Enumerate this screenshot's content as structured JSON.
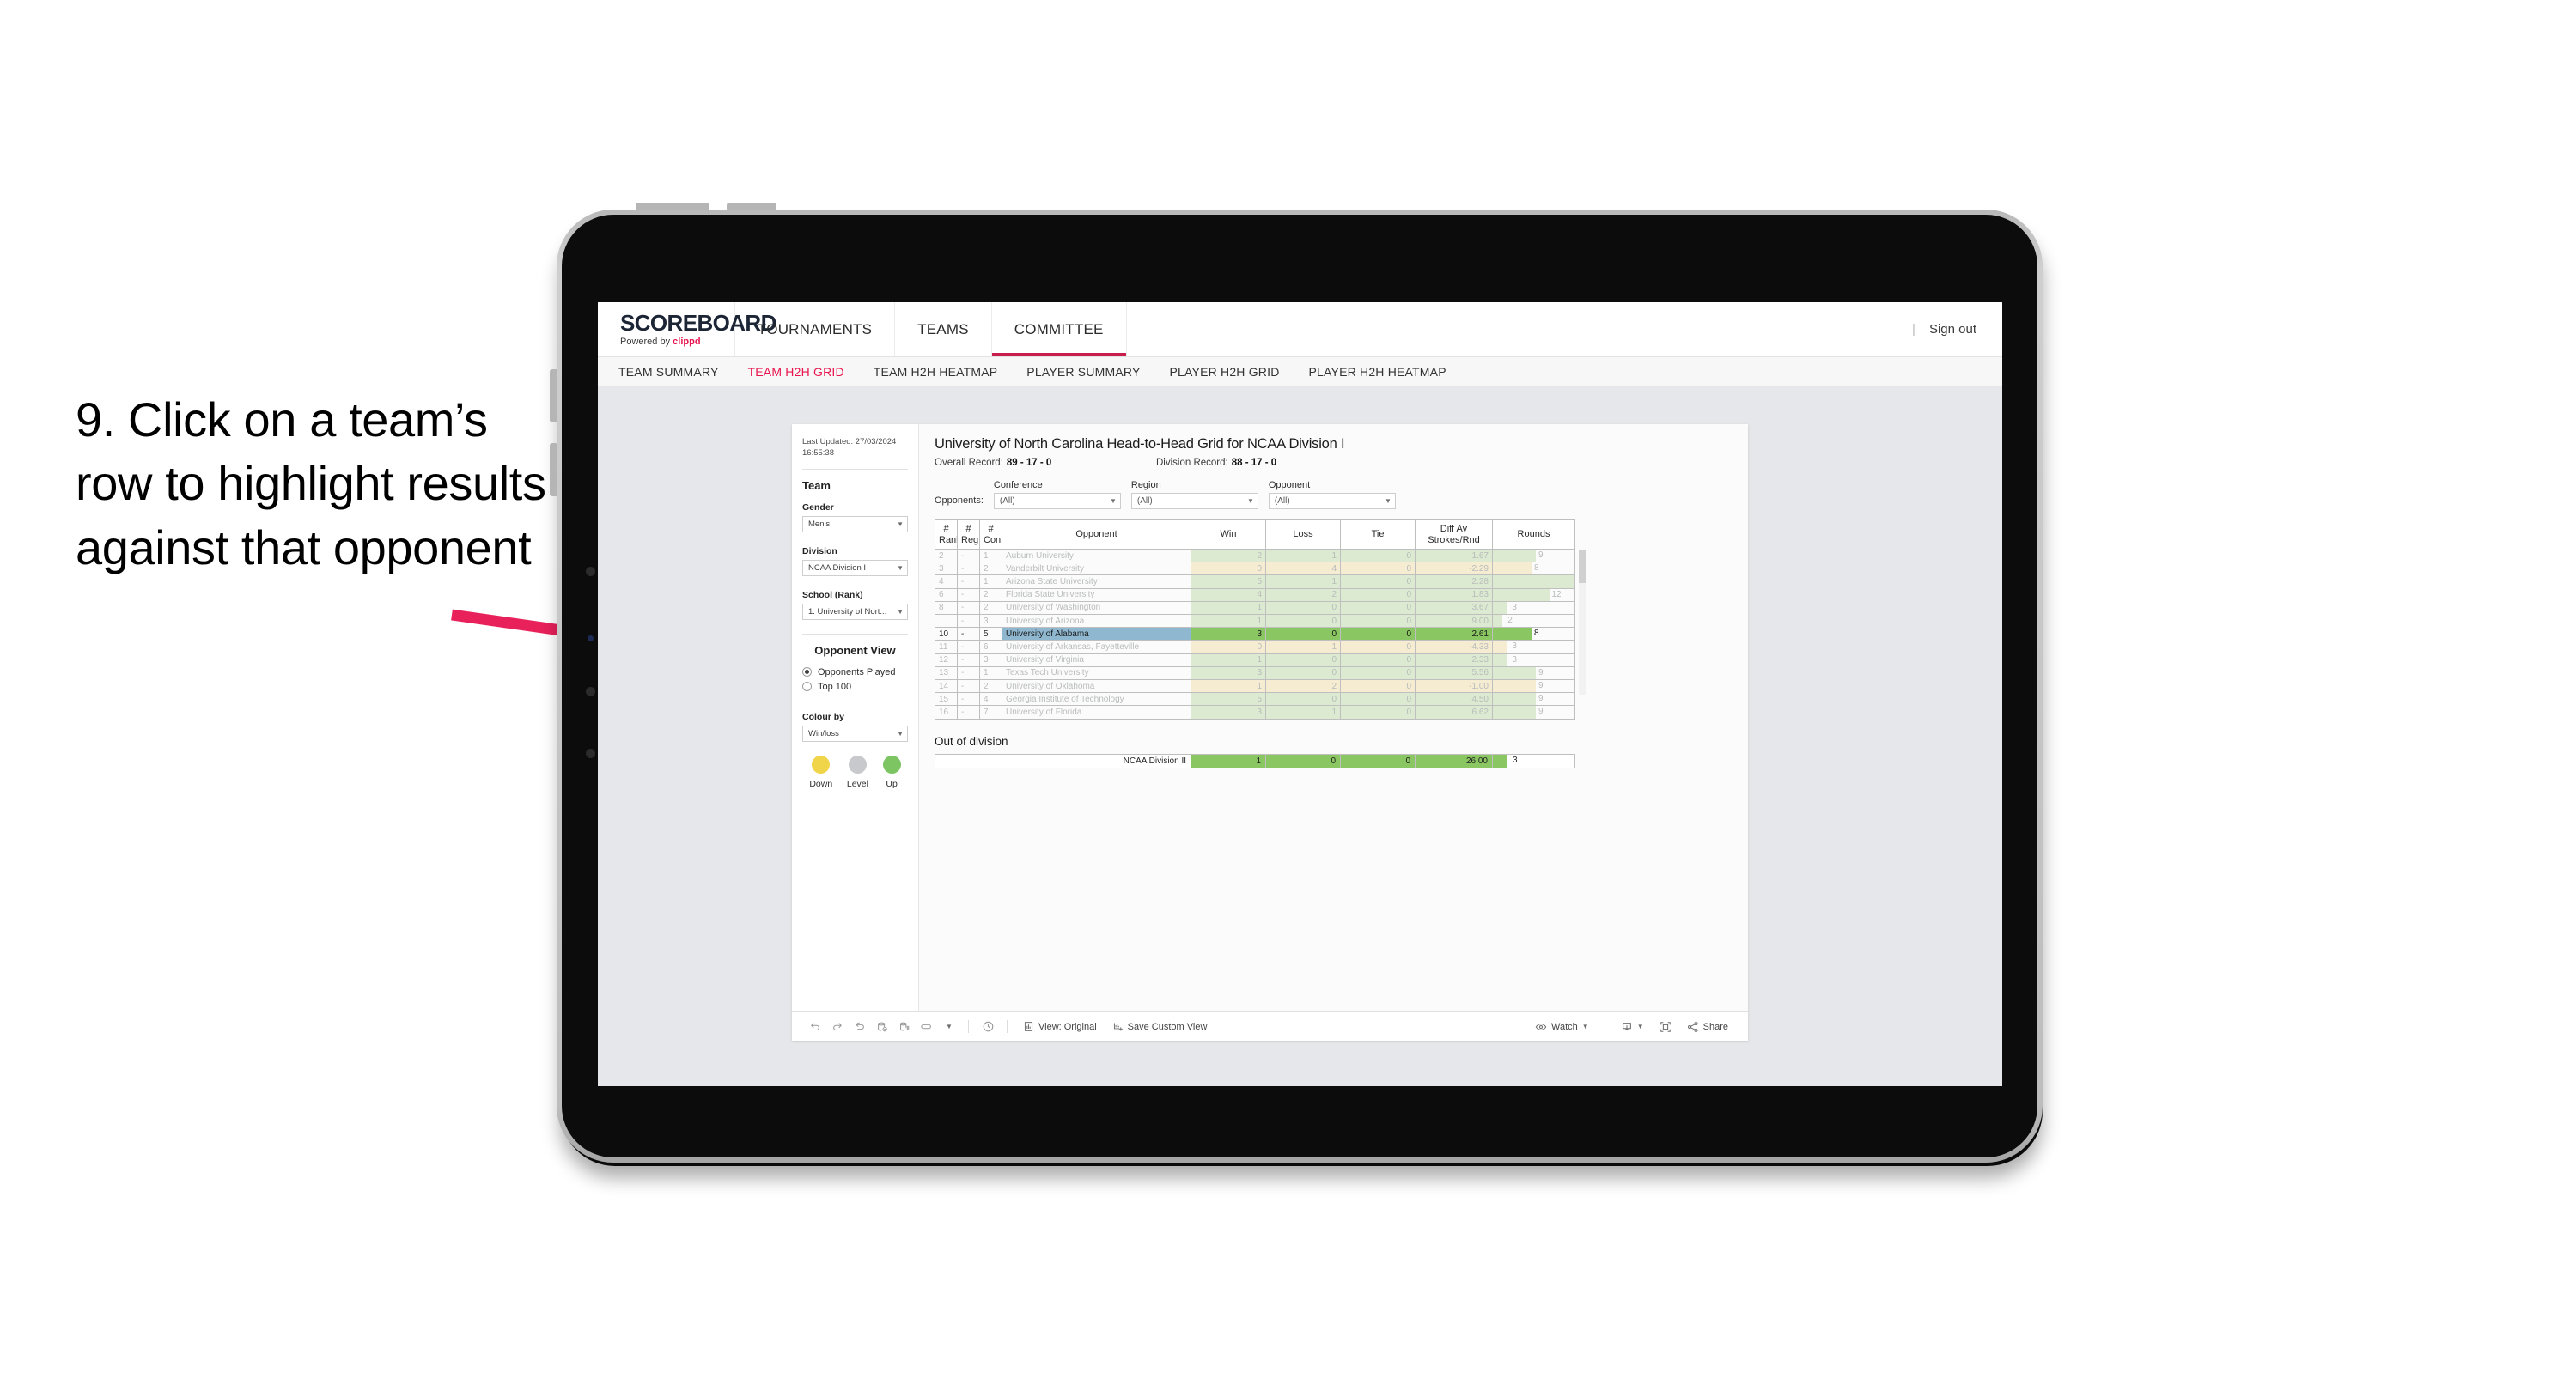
{
  "annotation": {
    "text": "9. Click on a team’s row to highlight results against that opponent",
    "arrow_color": "#E8215B"
  },
  "topbar": {
    "logo_word": "SCOREBOARD",
    "logo_sub_prefix": "Powered by ",
    "logo_sub_brand": "clippd",
    "nav": [
      {
        "label": "TOURNAMENTS",
        "active": false
      },
      {
        "label": "TEAMS",
        "active": false
      },
      {
        "label": "COMMITTEE",
        "active": true
      }
    ],
    "divider": "|",
    "sign_out": "Sign out"
  },
  "subnav": {
    "items": [
      {
        "label": "TEAM SUMMARY",
        "active": false
      },
      {
        "label": "TEAM H2H GRID",
        "active": true
      },
      {
        "label": "TEAM H2H HEATMAP",
        "active": false
      },
      {
        "label": "PLAYER SUMMARY",
        "active": false
      },
      {
        "label": "PLAYER H2H GRID",
        "active": false
      },
      {
        "label": "PLAYER H2H HEATMAP",
        "active": false
      }
    ]
  },
  "sidebar": {
    "last_updated": "Last Updated: 27/03/2024 16:55:38",
    "team_heading": "Team",
    "gender_label": "Gender",
    "gender_value": "Men’s",
    "division_label": "Division",
    "division_value": "NCAA Division I",
    "school_label": "School (Rank)",
    "school_value": "1. University of Nort...",
    "opponent_view_heading": "Opponent View",
    "opponent_view_options": [
      {
        "label": "Opponents Played",
        "selected": true
      },
      {
        "label": "Top 100",
        "selected": false
      }
    ],
    "colour_by_label": "Colour by",
    "colour_by_value": "Win/loss",
    "legend": [
      {
        "caption": "Down",
        "color": "#F0D54B"
      },
      {
        "caption": "Level",
        "color": "#C7C9CC"
      },
      {
        "caption": "Up",
        "color": "#7DC563"
      }
    ]
  },
  "viz": {
    "title": "University of North Carolina Head-to-Head Grid for NCAA Division I",
    "overall_record_label": "Overall Record:",
    "overall_record_value": "89 - 17 - 0",
    "division_record_label": "Division Record:",
    "division_record_value": "88 - 17 - 0",
    "filters_label": "Opponents:",
    "filters": [
      {
        "label": "Conference",
        "value": "(All)"
      },
      {
        "label": "Region",
        "value": "(All)"
      },
      {
        "label": "Opponent",
        "value": "(All)"
      }
    ]
  },
  "chart_data": {
    "type": "table",
    "title": "University of North Carolina Head-to-Head Grid for NCAA Division I",
    "columns": [
      "# Rank",
      "# Reg",
      "# Conf",
      "Opponent",
      "Win",
      "Loss",
      "Tie",
      "Diff Av Strokes/Rnd",
      "Rounds"
    ],
    "header_lines": [
      [
        "#",
        "Rank"
      ],
      [
        "#",
        "Reg"
      ],
      [
        "#",
        "Conf"
      ],
      [
        "Opponent"
      ],
      [
        "Win"
      ],
      [
        "Loss"
      ],
      [
        "Tie"
      ],
      [
        "Diff Av",
        "Strokes/Rnd"
      ],
      [
        "Rounds"
      ]
    ],
    "rounds_max": 17,
    "rows": [
      {
        "rank": "2",
        "reg": "-",
        "conf": "1",
        "opponent": "Auburn University",
        "win": "2",
        "loss": "1",
        "tie": "0",
        "diff": "1.67",
        "rounds": "9",
        "rounds_n": 9,
        "fill": "#dcead1",
        "highlight": false
      },
      {
        "rank": "3",
        "reg": "-",
        "conf": "2",
        "opponent": "Vanderbilt University",
        "win": "0",
        "loss": "4",
        "tie": "0",
        "diff": "-2.29",
        "rounds": "8",
        "rounds_n": 8,
        "fill": "#f5ecd2",
        "highlight": false
      },
      {
        "rank": "4",
        "reg": "-",
        "conf": "1",
        "opponent": "Arizona State University",
        "win": "5",
        "loss": "1",
        "tie": "0",
        "diff": "2.28",
        "rounds": "17",
        "rounds_n": 17,
        "fill": "#dcead1",
        "highlight": false
      },
      {
        "rank": "6",
        "reg": "-",
        "conf": "2",
        "opponent": "Florida State University",
        "win": "4",
        "loss": "2",
        "tie": "0",
        "diff": "1.83",
        "rounds": "12",
        "rounds_n": 12,
        "fill": "#dcead1",
        "highlight": false
      },
      {
        "rank": "8",
        "reg": "-",
        "conf": "2",
        "opponent": "University of Washington",
        "win": "1",
        "loss": "0",
        "tie": "0",
        "diff": "3.67",
        "rounds": "3",
        "rounds_n": 3,
        "fill": "#dcead1",
        "highlight": false
      },
      {
        "rank": "",
        "reg": "-",
        "conf": "3",
        "opponent": "University of Arizona",
        "win": "1",
        "loss": "0",
        "tie": "0",
        "diff": "9.00",
        "rounds": "2",
        "rounds_n": 2,
        "fill": "#dcead1",
        "highlight": false
      },
      {
        "rank": "10",
        "reg": "-",
        "conf": "5",
        "opponent": "University of Alabama",
        "win": "3",
        "loss": "0",
        "tie": "0",
        "diff": "2.61",
        "rounds": "8",
        "rounds_n": 8,
        "fill": "#8ac661",
        "highlight": true
      },
      {
        "rank": "11",
        "reg": "-",
        "conf": "6",
        "opponent": "University of Arkansas, Fayetteville",
        "win": "0",
        "loss": "1",
        "tie": "0",
        "diff": "-4.33",
        "rounds": "3",
        "rounds_n": 3,
        "fill": "#f5ecd2",
        "highlight": false
      },
      {
        "rank": "12",
        "reg": "-",
        "conf": "3",
        "opponent": "University of Virginia",
        "win": "1",
        "loss": "0",
        "tie": "0",
        "diff": "2.33",
        "rounds": "3",
        "rounds_n": 3,
        "fill": "#dcead1",
        "highlight": false
      },
      {
        "rank": "13",
        "reg": "-",
        "conf": "1",
        "opponent": "Texas Tech University",
        "win": "3",
        "loss": "0",
        "tie": "0",
        "diff": "5.56",
        "rounds": "9",
        "rounds_n": 9,
        "fill": "#dcead1",
        "highlight": false
      },
      {
        "rank": "14",
        "reg": "-",
        "conf": "2",
        "opponent": "University of Oklahoma",
        "win": "1",
        "loss": "2",
        "tie": "0",
        "diff": "-1.00",
        "rounds": "9",
        "rounds_n": 9,
        "fill": "#f5ecd2",
        "highlight": false
      },
      {
        "rank": "15",
        "reg": "-",
        "conf": "4",
        "opponent": "Georgia Institute of Technology",
        "win": "5",
        "loss": "0",
        "tie": "0",
        "diff": "4.50",
        "rounds": "9",
        "rounds_n": 9,
        "fill": "#dcead1",
        "highlight": false
      },
      {
        "rank": "16",
        "reg": "-",
        "conf": "7",
        "opponent": "University of Florida",
        "win": "3",
        "loss": "1",
        "tie": "0",
        "diff": "6.62",
        "rounds": "9",
        "rounds_n": 9,
        "fill": "#dcead1",
        "highlight": false
      }
    ]
  },
  "out_of_division": {
    "title": "Out of division",
    "row": {
      "label": "NCAA Division II",
      "win": "1",
      "loss": "0",
      "tie": "0",
      "diff": "26.00",
      "rounds": "3"
    }
  },
  "toolbar": {
    "icons": [
      "undo-icon",
      "redo-icon",
      "revert-icon",
      "refresh-icon",
      "pause-icon",
      "swap-icon"
    ],
    "view_label": "View: Original",
    "save_label": "Save Custom View",
    "watch_label": "Watch",
    "share_label": "Share"
  }
}
